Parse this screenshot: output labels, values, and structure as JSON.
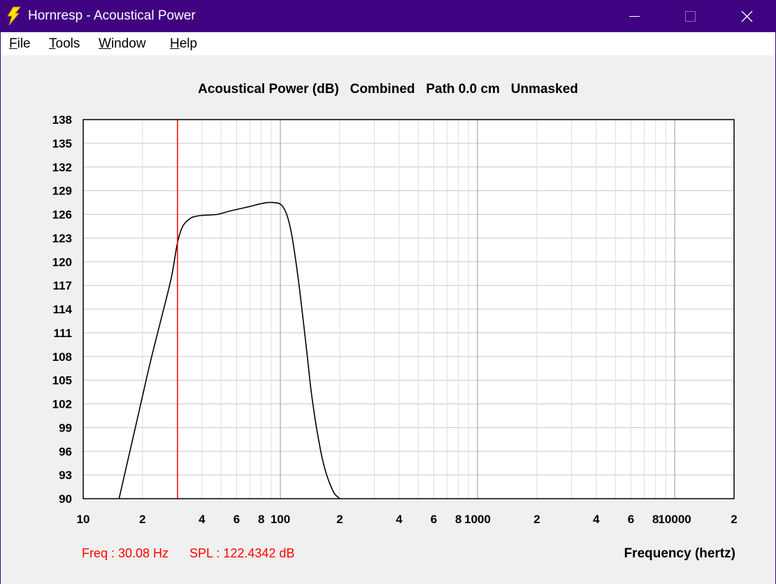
{
  "window": {
    "title": "Hornresp - Acoustical Power",
    "minimize_icon": "minimize-icon",
    "maximize_icon": "maximize-icon",
    "close_icon": "close-icon",
    "app_icon": "lightning-bolt-icon",
    "titlebar_color": "#3f0382"
  },
  "menu": {
    "items": [
      {
        "mnemonic": "F",
        "rest": "ile"
      },
      {
        "mnemonic": "T",
        "rest": "ools"
      },
      {
        "mnemonic": "W",
        "rest": "indow"
      },
      {
        "mnemonic": "H",
        "rest": "elp"
      }
    ]
  },
  "chart_data": {
    "type": "line",
    "title": "Acoustical Power (dB)   Combined   Path 0.0 cm   Unmasked",
    "xlabel": "Frequency (hertz)",
    "ylabel": "",
    "x_scale": "log",
    "xlim": [
      10,
      20000
    ],
    "ylim": [
      90,
      138
    ],
    "y_ticks": [
      90,
      93,
      96,
      99,
      102,
      105,
      108,
      111,
      114,
      117,
      120,
      123,
      126,
      129,
      132,
      135,
      138
    ],
    "x_tick_labels": [
      {
        "value": 10,
        "label": "10"
      },
      {
        "value": 20,
        "label": "2"
      },
      {
        "value": 40,
        "label": "4"
      },
      {
        "value": 60,
        "label": "6"
      },
      {
        "value": 80,
        "label": "8"
      },
      {
        "value": 100,
        "label": "100"
      },
      {
        "value": 200,
        "label": "2"
      },
      {
        "value": 400,
        "label": "4"
      },
      {
        "value": 600,
        "label": "6"
      },
      {
        "value": 800,
        "label": "8"
      },
      {
        "value": 1000,
        "label": "1000"
      },
      {
        "value": 2000,
        "label": "2"
      },
      {
        "value": 4000,
        "label": "4"
      },
      {
        "value": 6000,
        "label": "6"
      },
      {
        "value": 8000,
        "label": "8"
      },
      {
        "value": 10000,
        "label": "10000"
      },
      {
        "value": 20000,
        "label": "2"
      }
    ],
    "grid": true,
    "series": [
      {
        "color": "#000000",
        "x": [
          15.2,
          18,
          20,
          22,
          25,
          28,
          30.08,
          32,
          35,
          38,
          42,
          48,
          55,
          62,
          70,
          78,
          86,
          92,
          98,
          101,
          104,
          108,
          113,
          119,
          125,
          131,
          137,
          143,
          150,
          158,
          166,
          175,
          183,
          190,
          196,
          200
        ],
        "y": [
          90,
          98,
          103,
          107.5,
          113,
          118,
          122.43,
          124.5,
          125.5,
          125.8,
          125.9,
          126.0,
          126.4,
          126.7,
          127.0,
          127.3,
          127.5,
          127.5,
          127.4,
          127.2,
          126.8,
          125.9,
          124.0,
          120.6,
          116.6,
          112.3,
          108.0,
          103.8,
          100.1,
          96.8,
          94.3,
          92.4,
          91.2,
          90.5,
          90.2,
          90
        ]
      }
    ],
    "cursor": {
      "freq": 30.08,
      "color": "#ff0000"
    }
  },
  "readout": {
    "freq": "Freq : 30.08 Hz",
    "spl": "SPL : 122.4342 dB",
    "color": "#ff0000"
  }
}
